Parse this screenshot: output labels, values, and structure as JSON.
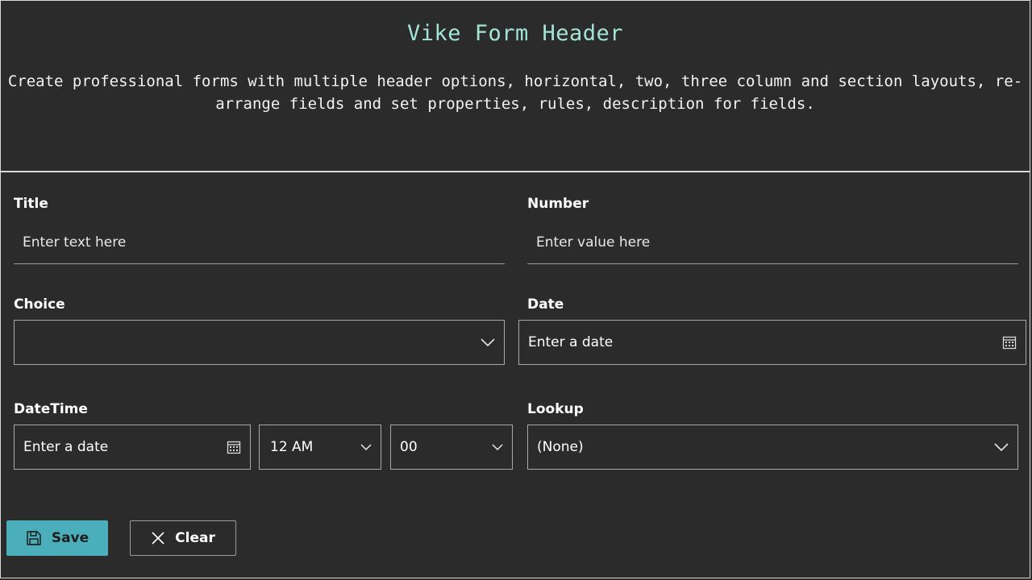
{
  "header": {
    "title": "Vike Form Header",
    "description": "Create professional forms with multiple header options, horizontal, two, three column and section layouts, re-arrange fields and set properties, rules, description for fields."
  },
  "fields": {
    "title": {
      "label": "Title",
      "placeholder": "Enter text here"
    },
    "number": {
      "label": "Number",
      "placeholder": "Enter value here"
    },
    "choice": {
      "label": "Choice",
      "value": ""
    },
    "date": {
      "label": "Date",
      "placeholder": "Enter a date"
    },
    "datetime": {
      "label": "DateTime",
      "placeholder": "Enter a date",
      "hour": "12 AM",
      "minute": "00"
    },
    "lookup": {
      "label": "Lookup",
      "value": "(None)"
    }
  },
  "actions": {
    "save_label": "Save",
    "clear_label": "Clear"
  },
  "icons": {
    "calendar": "calendar-icon",
    "chevron": "chevron-down-icon",
    "save": "save-icon",
    "close": "close-icon"
  },
  "colors": {
    "background": "#2b2b2b",
    "title": "#a3e4d7",
    "accent": "#4aaebb"
  }
}
